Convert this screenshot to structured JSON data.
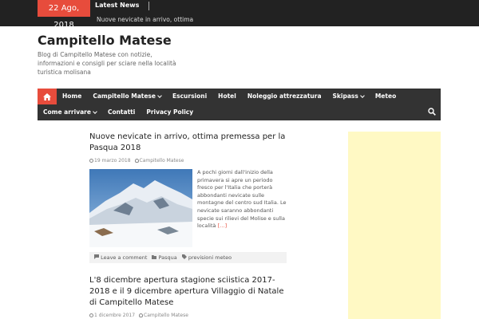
{
  "topbar": {
    "date": "22 Ago, 2018",
    "latest_label": "Latest News",
    "ticker": "Nuove nevicate in arrivo, ottima"
  },
  "header": {
    "title": "Campitello Matese",
    "description": "Blog di Campitello Matese con notizie, informazioni e consigli per sciare nella località turistica molisana"
  },
  "nav": {
    "row1": [
      {
        "label": "Home"
      },
      {
        "label": "Campitello Matese",
        "dropdown": true
      },
      {
        "label": "Escursioni"
      },
      {
        "label": "Hotel"
      },
      {
        "label": "Noleggio attrezzatura"
      },
      {
        "label": "Skipass",
        "dropdown": true
      },
      {
        "label": "Meteo"
      }
    ],
    "row2": [
      {
        "label": "Come arrivare",
        "dropdown": true
      },
      {
        "label": "Contatti"
      },
      {
        "label": "Privacy Policy"
      }
    ],
    "home_icon": "home-icon",
    "search_icon": "search-icon"
  },
  "posts": [
    {
      "title": "Nuove nevicate in arrivo, ottima premessa per la Pasqua 2018",
      "date": "19 marzo 2018",
      "author": "Campitello Matese",
      "excerpt": "A pochi giorni dall'inizio della primavera si apre un periodo fresco per l'Italia che porterà abbondanti nevicate sulle montagne del centro sud Italia. Le nevicate saranno abbondanti specie sui rilievi del Molise e sulla località",
      "more": "[…]",
      "comment": "Leave a comment",
      "category": "Pasqua",
      "tag": "previsioni meteo"
    },
    {
      "title": "L'8 dicembre apertura stagione sciistica 2017-2018 e il 9 dicembre apertura Villaggio di Natale di Campitello Matese",
      "date": "1 dicembre 2017",
      "author": "Campitello Matese"
    }
  ],
  "colors": {
    "accent": "#e74c3c",
    "nav_bg": "#333333",
    "topbar_bg": "#222222",
    "ad_bg": "#fff9c4"
  }
}
